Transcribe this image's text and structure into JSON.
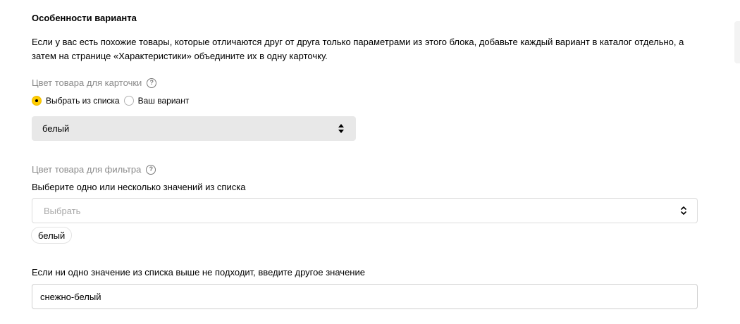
{
  "section": {
    "title": "Особенности варианта",
    "description": "Если у вас есть похожие товары, которые отличаются друг от друга только параметрами из этого блока, добавьте каждый вариант в каталог отдельно, а затем на странице «Характеристики» объедините их в одну карточку."
  },
  "card_color": {
    "label": "Цвет товара для карточки",
    "help_icon": "?",
    "options": [
      {
        "label": "Выбрать из списка",
        "checked": true
      },
      {
        "label": "Ваш вариант",
        "checked": false
      }
    ],
    "selected_value": "белый"
  },
  "filter_color": {
    "label": "Цвет товара для фильтра",
    "help_icon": "?",
    "instruction": "Выберите одно или несколько значений из списка",
    "select_placeholder": "Выбрать",
    "selected_tags": [
      "белый"
    ]
  },
  "custom_value": {
    "label": "Если ни одно значение из списка выше не подходит, введите другое значение",
    "value": "снежно-белый"
  },
  "colors": {
    "accent_radio": "#ffcc00",
    "muted_label": "#8a8a8a",
    "select_background": "#e8e8e8"
  }
}
